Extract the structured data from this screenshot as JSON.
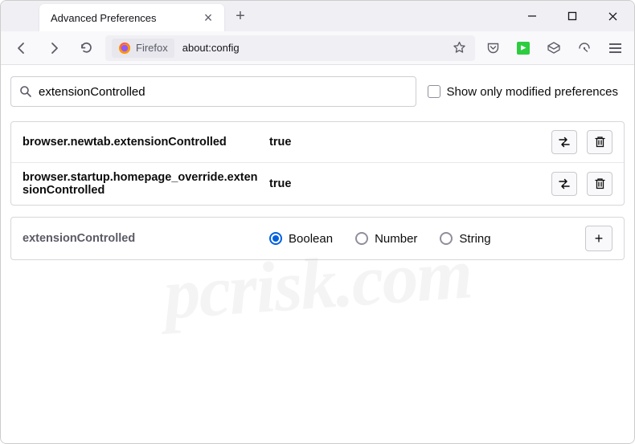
{
  "titlebar": {
    "tab_title": "Advanced Preferences"
  },
  "urlbar": {
    "identity_label": "Firefox",
    "url": "about:config"
  },
  "search": {
    "value": "extensionControlled",
    "checkbox_label": "Show only modified preferences"
  },
  "prefs": [
    {
      "name": "browser.newtab.extensionControlled",
      "value": "true"
    },
    {
      "name": "browser.startup.homepage_override.extensionControlled",
      "value": "true"
    }
  ],
  "add_row": {
    "name": "extensionControlled",
    "types": [
      {
        "label": "Boolean",
        "checked": true
      },
      {
        "label": "Number",
        "checked": false
      },
      {
        "label": "String",
        "checked": false
      }
    ]
  },
  "watermark": "pcrisk.com"
}
